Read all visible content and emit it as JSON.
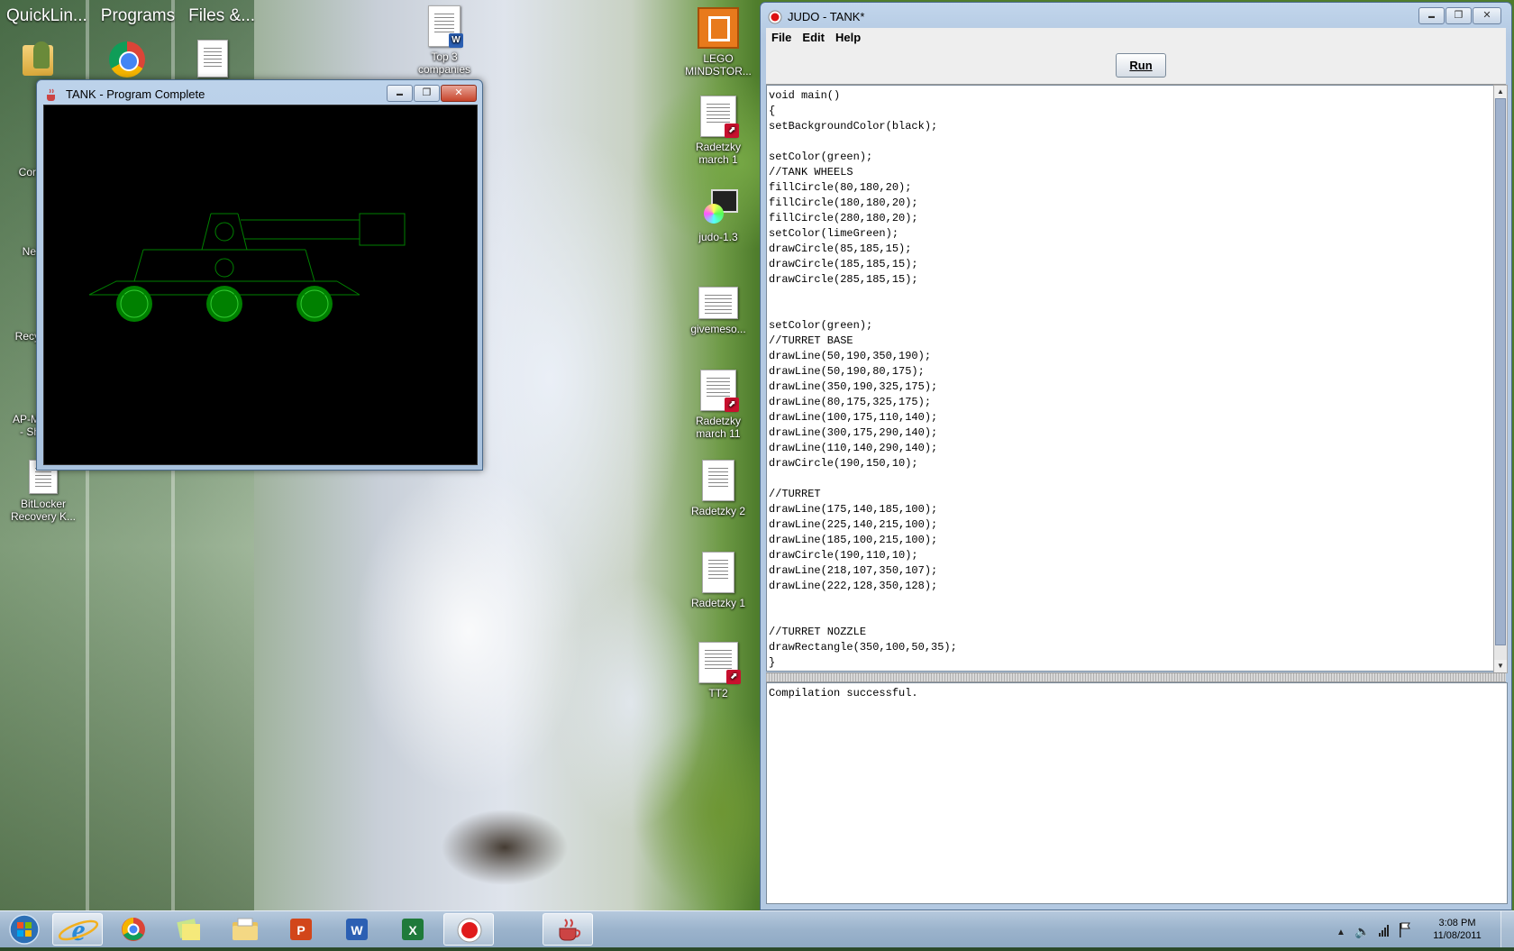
{
  "toolbar": {
    "items": [
      "QuickLin...",
      "Programs",
      "Files &..."
    ]
  },
  "desktop": {
    "left_icons": [
      {
        "label": "N"
      },
      {
        "label": "Cor"
      },
      {
        "label": "Ne"
      },
      {
        "label": "Recy"
      },
      {
        "label": "AP-M\n- Sh"
      },
      {
        "label": "BitLocker\nRecovery K..."
      }
    ],
    "right_icons": [
      {
        "label": "Top 3\ncompanies"
      },
      {
        "label": "LEGO\nMINDSTOR..."
      },
      {
        "label": "Radetzky\nmarch 1"
      },
      {
        "label": "judo-1.3"
      },
      {
        "label": "givemeso..."
      },
      {
        "label": "Radetzky\nmarch 11"
      },
      {
        "label": "Radetzky 2"
      },
      {
        "label": "Radetzky 1"
      },
      {
        "label": "TT2"
      }
    ]
  },
  "tank_window": {
    "title": "TANK - Program Complete",
    "buttons": {
      "minimize": "▬",
      "maximize": "❐",
      "close": "✕"
    },
    "canvas_background": "#000000"
  },
  "judo_window": {
    "title": "JUDO - TANK*",
    "buttons": {
      "minimize": "▬",
      "maximize": "❐",
      "close": "✕"
    },
    "menu": [
      "File",
      "Edit",
      "Help"
    ],
    "run_label": "Run",
    "code": "void main()\n{\nsetBackgroundColor(black);\n\nsetColor(green);\n//TANK WHEELS\nfillCircle(80,180,20);\nfillCircle(180,180,20);\nfillCircle(280,180,20);\nsetColor(limeGreen);\ndrawCircle(85,185,15);\ndrawCircle(185,185,15);\ndrawCircle(285,185,15);\n\n\nsetColor(green);\n//TURRET BASE\ndrawLine(50,190,350,190);\ndrawLine(50,190,80,175);\ndrawLine(350,190,325,175);\ndrawLine(80,175,325,175);\ndrawLine(100,175,110,140);\ndrawLine(300,175,290,140);\ndrawLine(110,140,290,140);\ndrawCircle(190,150,10);\n\n//TURRET\ndrawLine(175,140,185,100);\ndrawLine(225,140,215,100);\ndrawLine(185,100,215,100);\ndrawCircle(190,110,10);\ndrawLine(218,107,350,107);\ndrawLine(222,128,350,128);\n\n\n//TURRET NOZZLE\ndrawRectangle(350,100,50,35);\n}",
    "console_text": "Compilation successful."
  },
  "colors": {
    "green": "#008000",
    "limeGreen": "#32cd32"
  },
  "taskbar": {
    "pinned": [
      "start-orb",
      "internet-explorer",
      "chrome",
      "sticky-notes",
      "windows-explorer",
      "powerpoint",
      "word",
      "excel",
      "judo-record",
      "java-app"
    ],
    "clock_time": "3:08 PM",
    "clock_date": "11/08/2011"
  }
}
